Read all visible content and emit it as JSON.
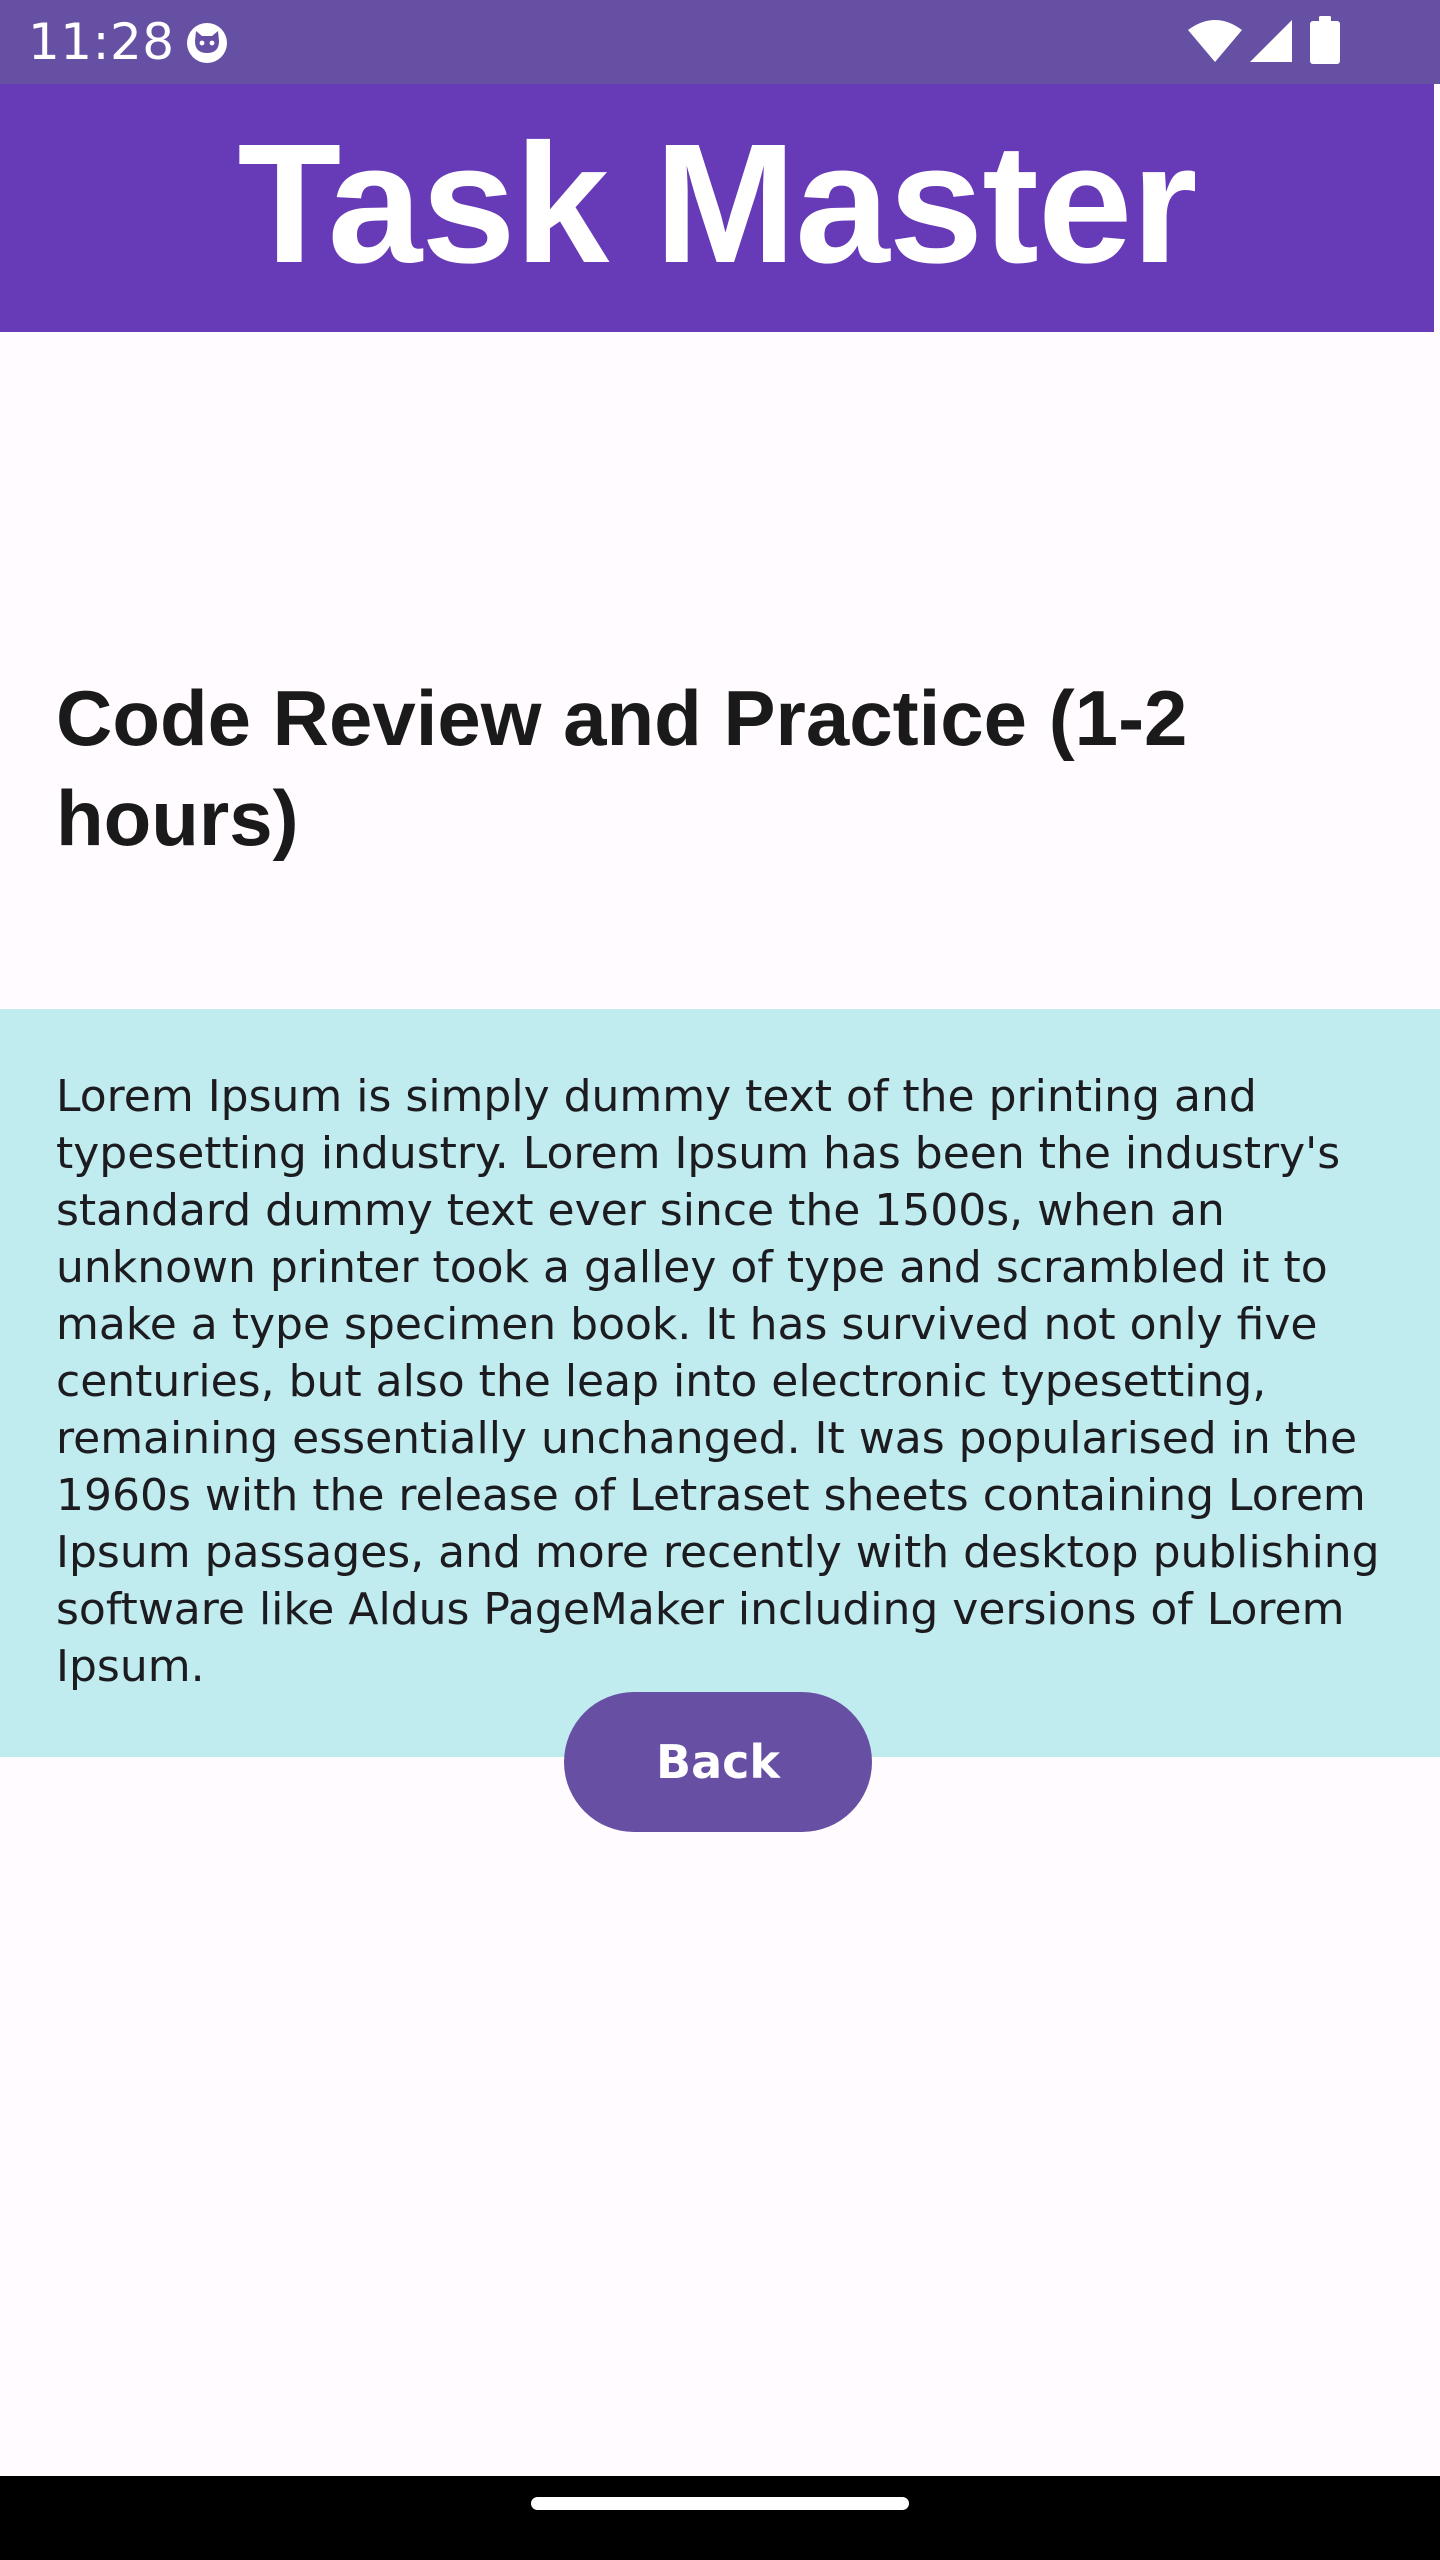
{
  "status_bar": {
    "time": "11:28",
    "app_icon": "cat-face-icon",
    "wifi_icon": "wifi-icon",
    "signal_icon": "cell-signal-icon",
    "battery_icon": "battery-icon",
    "background_color": "#6650A4"
  },
  "app_bar": {
    "title": "Task Master",
    "background_color": "#673AB7"
  },
  "task": {
    "title": "Code Review and Practice (1-2 hours)",
    "description": "Lorem Ipsum is simply dummy text of the printing and typesetting industry. Lorem Ipsum has been the industry's standard dummy text ever since the 1500s, when an unknown printer took a galley of type and scrambled it to make a type specimen book. It has survived not only five centuries, but also the leap into electronic typesetting, remaining essentially unchanged. It was popularised in the 1960s with the release of Letraset sheets containing Lorem Ipsum passages, and more recently with desktop publishing software like Aldus PageMaker including versions of Lorem Ipsum.",
    "description_background_color": "#C0EBEF"
  },
  "actions": {
    "back_label": "Back",
    "button_color": "#6750A4"
  }
}
